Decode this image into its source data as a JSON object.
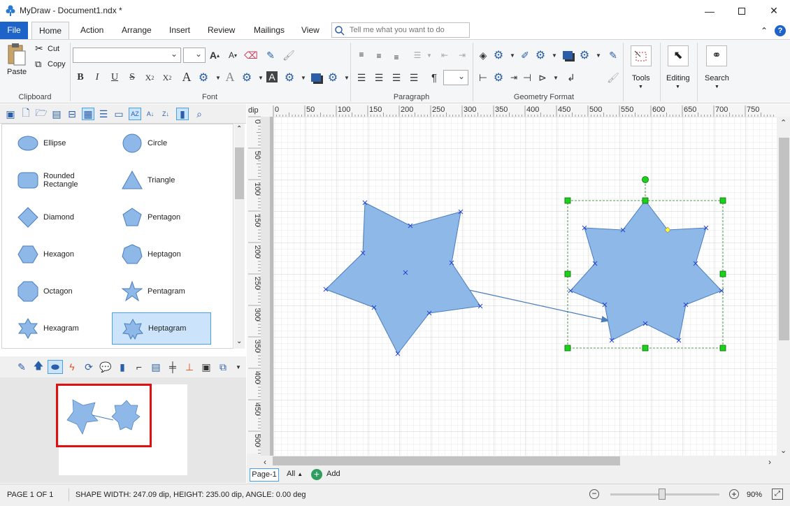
{
  "window": {
    "title": "MyDraw - Document1.ndx *",
    "minimize_icon": "minimize-icon",
    "maximize_icon": "maximize-icon",
    "close_icon": "close-icon"
  },
  "tabs": [
    "File",
    "Home",
    "Action",
    "Arrange",
    "Insert",
    "Review",
    "Mailings",
    "View"
  ],
  "active_tab": "Home",
  "tellme": {
    "placeholder": "Tell me what you want to do"
  },
  "ribbon": {
    "clipboard": {
      "label": "Clipboard",
      "paste": "Paste",
      "cut": "Cut",
      "copy": "Copy"
    },
    "font": {
      "label": "Font",
      "font_name": "",
      "font_size": ""
    },
    "paragraph": {
      "label": "Paragraph"
    },
    "geometry": {
      "label": "Geometry Format"
    },
    "tools": {
      "label": "Tools"
    },
    "editing": {
      "label": "Editing"
    },
    "search": {
      "label": "Search"
    }
  },
  "shapes": [
    {
      "name": "Ellipse",
      "icon": "ellipse"
    },
    {
      "name": "Circle",
      "icon": "circle"
    },
    {
      "name": "Rounded Rectangle",
      "icon": "rounded-rectangle"
    },
    {
      "name": "Triangle",
      "icon": "triangle"
    },
    {
      "name": "Diamond",
      "icon": "diamond"
    },
    {
      "name": "Pentagon",
      "icon": "pentagon"
    },
    {
      "name": "Hexagon",
      "icon": "hexagon"
    },
    {
      "name": "Heptagon",
      "icon": "heptagon"
    },
    {
      "name": "Octagon",
      "icon": "octagon"
    },
    {
      "name": "Pentagram",
      "icon": "pentagram"
    },
    {
      "name": "Hexagram",
      "icon": "hexagram"
    },
    {
      "name": "Heptagram",
      "icon": "heptagram",
      "selected": true
    }
  ],
  "ruler": {
    "unit": "dip",
    "h_ticks": [
      "0",
      "50",
      "100",
      "150",
      "200",
      "250",
      "300",
      "350",
      "400",
      "450",
      "500",
      "550",
      "600",
      "650",
      "700",
      "750"
    ],
    "v_ticks": [
      "0",
      "50",
      "100",
      "150",
      "200",
      "250",
      "300",
      "350",
      "400",
      "450",
      "500"
    ]
  },
  "pages": {
    "current": "Page-1",
    "all_label": "All",
    "add_label": "Add"
  },
  "status": {
    "page": "PAGE 1 OF 1",
    "shape_info": "SHAPE WIDTH: 247.09 dip, HEIGHT: 235.00 dip, ANGLE: 0.00 deg",
    "zoom": "90%",
    "zoom_level": 0.9
  },
  "colors": {
    "file_tab": "#1e64c8",
    "shape_fill": "#8db8e8",
    "shape_stroke": "#4a7dbd",
    "selection_handle": "#19d219",
    "overview_frame": "#e01010"
  }
}
